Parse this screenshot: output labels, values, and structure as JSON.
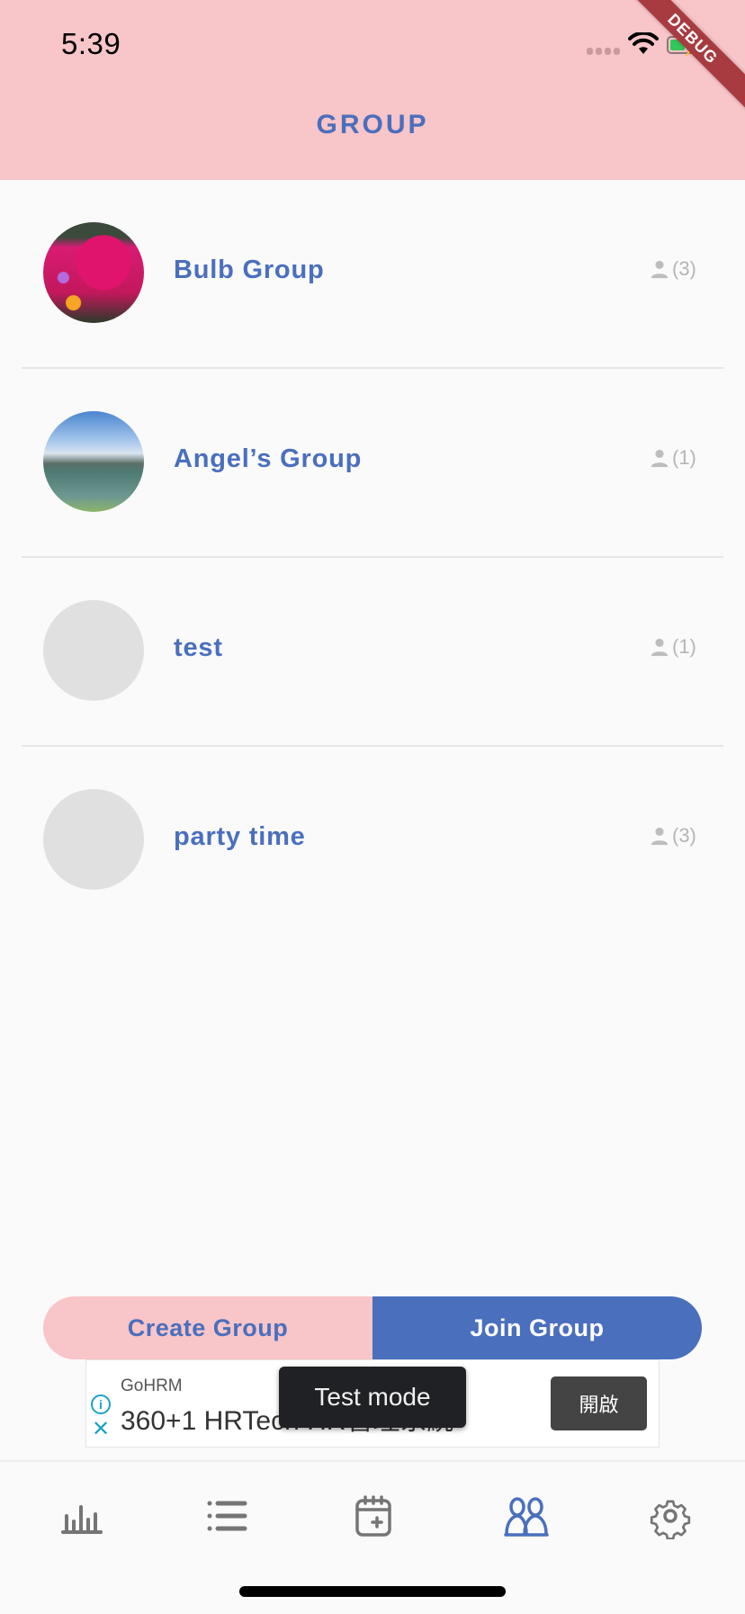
{
  "status_bar": {
    "time": "5:39",
    "debug_banner": "DEBUG"
  },
  "header": {
    "title": "GROUP",
    "background_color": "#f8c5c8",
    "accent_color": "#4a6fbd"
  },
  "groups": [
    {
      "name": "Bulb Group",
      "member_count": "(3)",
      "avatar": "flowers-photo"
    },
    {
      "name": "Angel’s Group",
      "member_count": "(1)",
      "avatar": "lake-photo"
    },
    {
      "name": "test",
      "member_count": "(1)",
      "avatar": "placeholder"
    },
    {
      "name": "party time",
      "member_count": "(3)",
      "avatar": "placeholder"
    }
  ],
  "actions": {
    "create_label": "Create Group",
    "join_label": "Join Group"
  },
  "ad": {
    "advertiser": "GoHRM",
    "headline": "360+1 HRTech HR管理系統",
    "open_label": "開啟",
    "toast": "Test mode"
  },
  "tabbar": {
    "items": [
      {
        "icon": "bar-chart-icon",
        "active": false
      },
      {
        "icon": "list-icon",
        "active": false
      },
      {
        "icon": "calendar-add-icon",
        "active": false
      },
      {
        "icon": "group-icon",
        "active": true
      },
      {
        "icon": "gear-icon",
        "active": false
      }
    ],
    "active_color": "#4a6fbd",
    "inactive_color": "#757575"
  }
}
